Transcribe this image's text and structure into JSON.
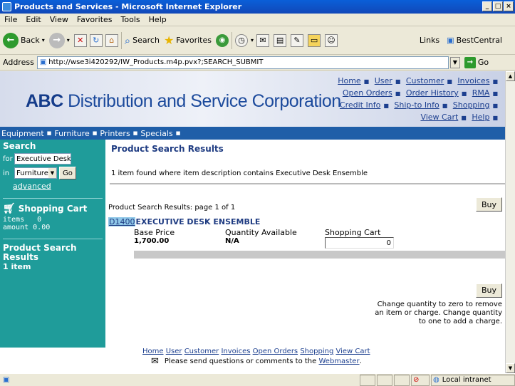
{
  "window": {
    "title": "Products and Services - Microsoft Internet Explorer"
  },
  "menu": [
    "File",
    "Edit",
    "View",
    "Favorites",
    "Tools",
    "Help"
  ],
  "toolbar": {
    "back": "Back",
    "search": "Search",
    "favorites": "Favorites",
    "links": "Links",
    "bestcentral": "BestCentral"
  },
  "address": {
    "label": "Address",
    "url": "http://wse3i420292/IW_Products.m4p.pvx?;SEARCH_SUBMIT",
    "go": "Go"
  },
  "banner": {
    "abc": "ABC",
    "name": "Distribution and Service Corporation"
  },
  "toplinks": {
    "row1": [
      "Home",
      "User",
      "Customer",
      "Invoices"
    ],
    "row2": [
      "Open Orders",
      "Order History",
      "RMA"
    ],
    "row3": [
      "Credit Info",
      "Ship-to Info",
      "Shopping"
    ],
    "row4": [
      "View Cart",
      "Help"
    ]
  },
  "categories": [
    "Equipment",
    "Furniture",
    "Printers",
    "Specials"
  ],
  "sidebar": {
    "search_title": "Search",
    "for_label": "for",
    "for_value": "Executive Desk E",
    "in_label": "in",
    "in_value": "Furniture",
    "go": "Go",
    "advanced": "advanced",
    "cart_title": "Shopping Cart",
    "items_label": "items",
    "items_value": "0",
    "amount_label": "amount",
    "amount_value": "0.00",
    "results_title_1": "Product Search",
    "results_title_2": "Results",
    "results_count": "1 item"
  },
  "main": {
    "title": "Product Search Results",
    "summary": "1 item found where item description contains Executive Desk Ensemble",
    "page_info": "Product Search Results: page 1 of 1",
    "buy": "Buy",
    "item_code": "D1400",
    "item_name": "EXECUTIVE DESK ENSEMBLE",
    "col_base": "Base Price",
    "col_qty": "Quantity Available",
    "col_cart": "Shopping Cart",
    "base_price": "1,700.00",
    "qty": "N/A",
    "cart_qty": "0",
    "note1": "Change quantity to zero to remove",
    "note2": "an item or charge. Change quantity",
    "note3": "to one to add a charge."
  },
  "footer": {
    "links": [
      "Home",
      "User",
      "Customer",
      "Invoices",
      "Open Orders",
      "Shopping",
      "View Cart"
    ],
    "msg": "Please send questions or comments to the",
    "webmaster": "Webmaster",
    "period": "."
  },
  "status": {
    "zone": "Local intranet"
  }
}
